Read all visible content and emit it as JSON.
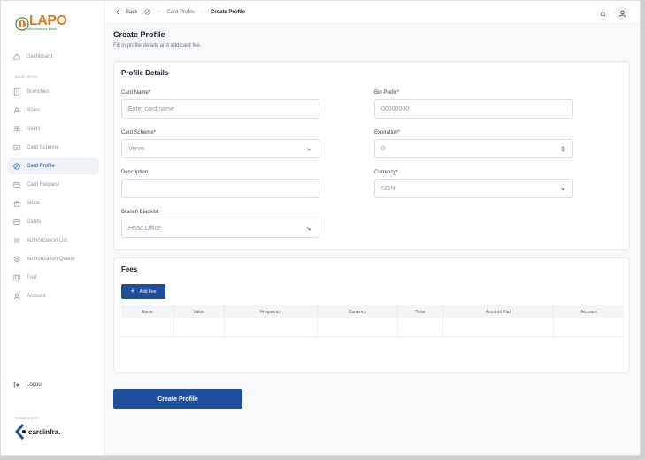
{
  "brand": {
    "logo_text": "LAPO",
    "logo_sub": "Microfinance Bank",
    "powered_by": "POWERED BY",
    "footer_brand": "cardinfra."
  },
  "sidebar": {
    "section_label": "MAIN MENU",
    "items": [
      {
        "label": "Dashboard",
        "icon": "home-icon"
      },
      {
        "label": "Branches",
        "icon": "building-icon"
      },
      {
        "label": "Roles",
        "icon": "user-icon"
      },
      {
        "label": "Users",
        "icon": "users-icon"
      },
      {
        "label": "Card Scheme",
        "icon": "card-scheme-icon"
      },
      {
        "label": "Card Profile",
        "icon": "card-profile-icon"
      },
      {
        "label": "Card Request",
        "icon": "card-request-icon"
      },
      {
        "label": "Stock",
        "icon": "stock-icon"
      },
      {
        "label": "Cards",
        "icon": "cards-icon"
      },
      {
        "label": "Authorization List",
        "icon": "list-icon"
      },
      {
        "label": "Authorization Queue",
        "icon": "queue-icon"
      },
      {
        "label": "Trail",
        "icon": "map-icon"
      },
      {
        "label": "Account",
        "icon": "account-icon"
      }
    ],
    "active_item": "Card Profile",
    "logout_label": "Logout"
  },
  "breadcrumb": {
    "back_label": "Back",
    "parent": "Card Profile",
    "current": "Create Profile"
  },
  "page": {
    "title": "Create Profile",
    "subtitle": "Fill in profile details and add card fee."
  },
  "profile_details": {
    "title": "Profile Details",
    "card_name": {
      "label": "Card Name*",
      "placeholder": "Enter card name",
      "value": ""
    },
    "bin_prefix": {
      "label": "Bin Prefix*",
      "placeholder": "00000000",
      "value": ""
    },
    "card_scheme": {
      "label": "Card Scheme*",
      "value": "Verve"
    },
    "expiration": {
      "label": "Expiration*",
      "value": "0"
    },
    "description": {
      "label": "Description",
      "value": ""
    },
    "currency": {
      "label": "Currency*",
      "value": "NGN"
    },
    "branch_blacklist": {
      "label": "Branch Blacklist",
      "value": "Head Office"
    }
  },
  "fees": {
    "title": "Fees",
    "add_button": "Add Fee",
    "columns": [
      "Name",
      "Value",
      "Frequency",
      "Currency",
      "Time",
      "Account Pad",
      "Account"
    ]
  },
  "submit_label": "Create Profile",
  "colors": {
    "primary": "#1d4f9c",
    "brand_orange": "#e07a1f",
    "brand_green": "#3a8a3a"
  }
}
